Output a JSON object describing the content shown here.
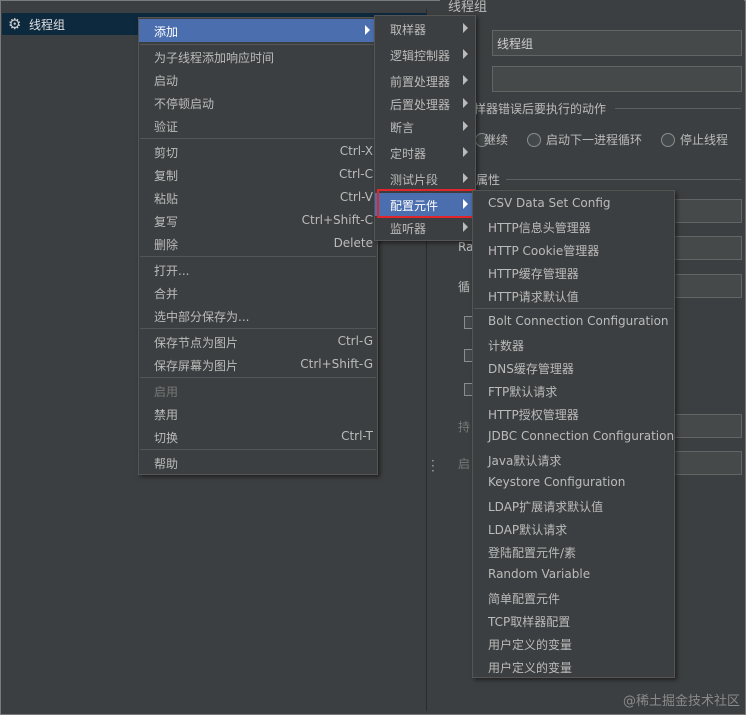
{
  "tree": {
    "root_label": "线程组",
    "root_icon": "gear-icon"
  },
  "right_panel": {
    "title": "线程组",
    "name_value": "线程组",
    "comment_value": "",
    "on_error_label": "样器错误后要执行的动作",
    "radio_continue": "继续",
    "radio_next_loop": "启动下一进程循环",
    "radio_stop": "停止线程",
    "props_label": "属性",
    "ramp_label": "Ra",
    "loop_label": "循",
    "duration_label": "持",
    "delay_label": "启"
  },
  "context_menu": {
    "add": "添加",
    "group1": [
      {
        "label": "为子线程添加响应时间"
      },
      {
        "label": "启动"
      },
      {
        "label": "不停顿启动"
      },
      {
        "label": "验证"
      }
    ],
    "group2": [
      {
        "label": "剪切",
        "shortcut": "Ctrl-X"
      },
      {
        "label": "复制",
        "shortcut": "Ctrl-C"
      },
      {
        "label": "粘贴",
        "shortcut": "Ctrl-V"
      },
      {
        "label": "复写",
        "shortcut": "Ctrl+Shift-C"
      },
      {
        "label": "删除",
        "shortcut": "Delete"
      }
    ],
    "group3": [
      {
        "label": "打开..."
      },
      {
        "label": "合并"
      },
      {
        "label": "选中部分保存为..."
      }
    ],
    "group4": [
      {
        "label": "保存节点为图片",
        "shortcut": "Ctrl-G"
      },
      {
        "label": "保存屏幕为图片",
        "shortcut": "Ctrl+Shift-G"
      }
    ],
    "group5": [
      {
        "label": "启用"
      },
      {
        "label": "禁用"
      },
      {
        "label": "切换",
        "shortcut": "Ctrl-T"
      }
    ],
    "help": "帮助"
  },
  "add_submenu": [
    "取样器",
    "逻辑控制器",
    "前置处理器",
    "后置处理器",
    "断言",
    "定时器",
    "测试片段",
    "配置元件",
    "监听器"
  ],
  "config_submenu": {
    "group1": [
      "CSV Data Set Config",
      "HTTP信息头管理器",
      "HTTP Cookie管理器",
      "HTTP缓存管理器",
      "HTTP请求默认值"
    ],
    "group2": [
      "Bolt Connection Configuration",
      "计数器",
      "DNS缓存管理器",
      "FTP默认请求",
      "HTTP授权管理器",
      "JDBC Connection Configuration",
      "Java默认请求",
      "Keystore Configuration",
      "LDAP扩展请求默认值",
      "LDAP默认请求",
      "登陆配置元件/素",
      "Random Variable",
      "简单配置元件",
      "TCP取样器配置",
      "用户定义的变量",
      "用户定义的变量"
    ]
  },
  "watermark": "@稀土掘金技术社区",
  "colors": {
    "highlight": "#4b6eaf",
    "annotation_box": "#e0262b",
    "background": "#3c3f41"
  }
}
